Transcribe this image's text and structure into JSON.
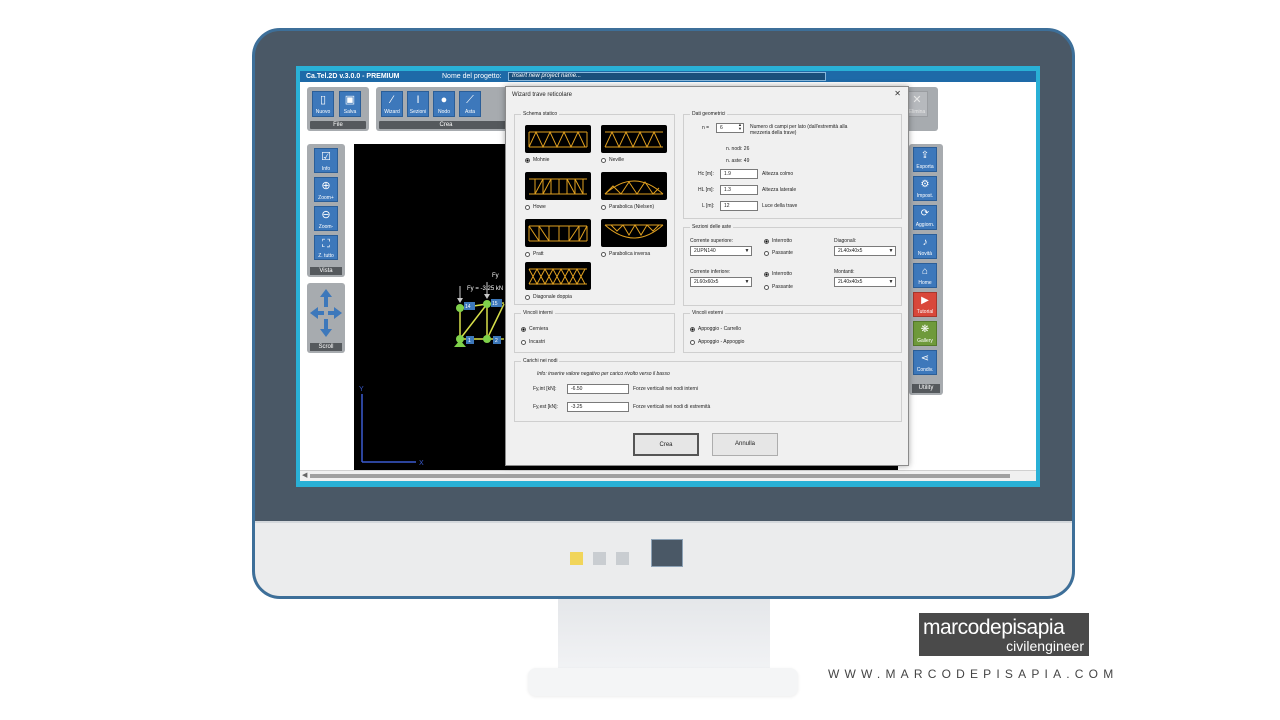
{
  "app": {
    "title": "Ca.Tel.2D v.3.0.0 - PREMIUM",
    "project_label": "Nome del progetto:",
    "project_placeholder": "Insert new project name..."
  },
  "ribbon": {
    "file_group": "File",
    "crea_group": "Crea",
    "buttons": {
      "nuovo": "Nuovo",
      "salva": "Salva",
      "wizard": "Wizard",
      "sezioni": "Sezioni",
      "nodo": "Nodo",
      "asta": "Asta",
      "elimina": "Elimina"
    }
  },
  "leftbar": {
    "vista_label": "Vista",
    "scroll_label": "Scroll",
    "buttons": {
      "info": "Info",
      "zoom_in": "Zoom+",
      "zoom_out": "Zoom-",
      "zoom_all": "Z. tutto"
    }
  },
  "rightbar": {
    "utility_label": "Utility",
    "buttons": {
      "esporta": "Esporta",
      "impost": "Impost.",
      "aggiorn": "Aggiorn.",
      "novita": "Novità",
      "home": "Home",
      "tutorial": "Tutorial",
      "gallery": "Gallery",
      "condiv": "Condiv."
    }
  },
  "canvas": {
    "axis_y": "Y",
    "axis_x": "X",
    "load_text": "Fy = -3.25 kN",
    "load_text2": "Fy",
    "node_labels": [
      "14",
      "15",
      "1",
      "2"
    ]
  },
  "dialog": {
    "title": "Wizard trave reticolare",
    "schema": {
      "legend": "Schema statico",
      "options": [
        "Mohnie",
        "Neville",
        "Howe",
        "Parabolica (Nielsen)",
        "Pratt",
        "Parabolica inversa",
        "Diagonale doppia"
      ],
      "selected": "Mohnie"
    },
    "geometria": {
      "legend": "Dati geometrici",
      "n_label": "n =",
      "n_value": "6",
      "n_desc": "Numero di campi per lato (dall'estremità alla mezzeria della trave)",
      "nodi": "n. nodi:  26",
      "aste": "n. aste:  49",
      "hc_label": "Hc [m]:",
      "hc_value": "1.9",
      "hc_desc": "Altezza colmo",
      "hl_label": "HL [m]:",
      "hl_value": "1.3",
      "hl_desc": "Altezza laterale",
      "l_label": "L [m]:",
      "l_value": "12",
      "l_desc": "Luce della trave"
    },
    "sezioni": {
      "legend": "Sezioni delle aste",
      "sup_label": "Corrente superiore:",
      "sup_value": "2UPN140",
      "inf_label": "Corrente inferiore:",
      "inf_value": "2L60x60x5",
      "interrotto": "Interrotto",
      "passante": "Passante",
      "diag_label": "Diagonali:",
      "diag_value": "2L40x40x5",
      "mont_label": "Montanti:",
      "mont_value": "2L40x40x5"
    },
    "vincoli_interni": {
      "legend": "Vincoli interni",
      "opt1": "Cerniera",
      "opt2": "Incastri"
    },
    "vincoli_esterni": {
      "legend": "Vincoli esterni",
      "opt1": "Appoggio - Carrello",
      "opt2": "Appoggio - Appoggio"
    },
    "carichi": {
      "legend": "Carichi nei nodi",
      "info": "Info: inserire valore negativo per carico rivolto verso il basso",
      "int_label": "Fy,int [kN]:",
      "int_value": "-6.50",
      "int_desc": "Forze verticali nei nodi interni",
      "est_label": "Fy,est [kN]:",
      "est_value": "-3.25",
      "est_desc": "Forze verticali nei nodi di estremità"
    },
    "crea": "Crea",
    "annulla": "Annulla"
  },
  "branding": {
    "logo_line1": "marcodepisapia",
    "logo_line2": "civilengineer",
    "website": "WWW.MARCODEPISAPIA.COM"
  }
}
